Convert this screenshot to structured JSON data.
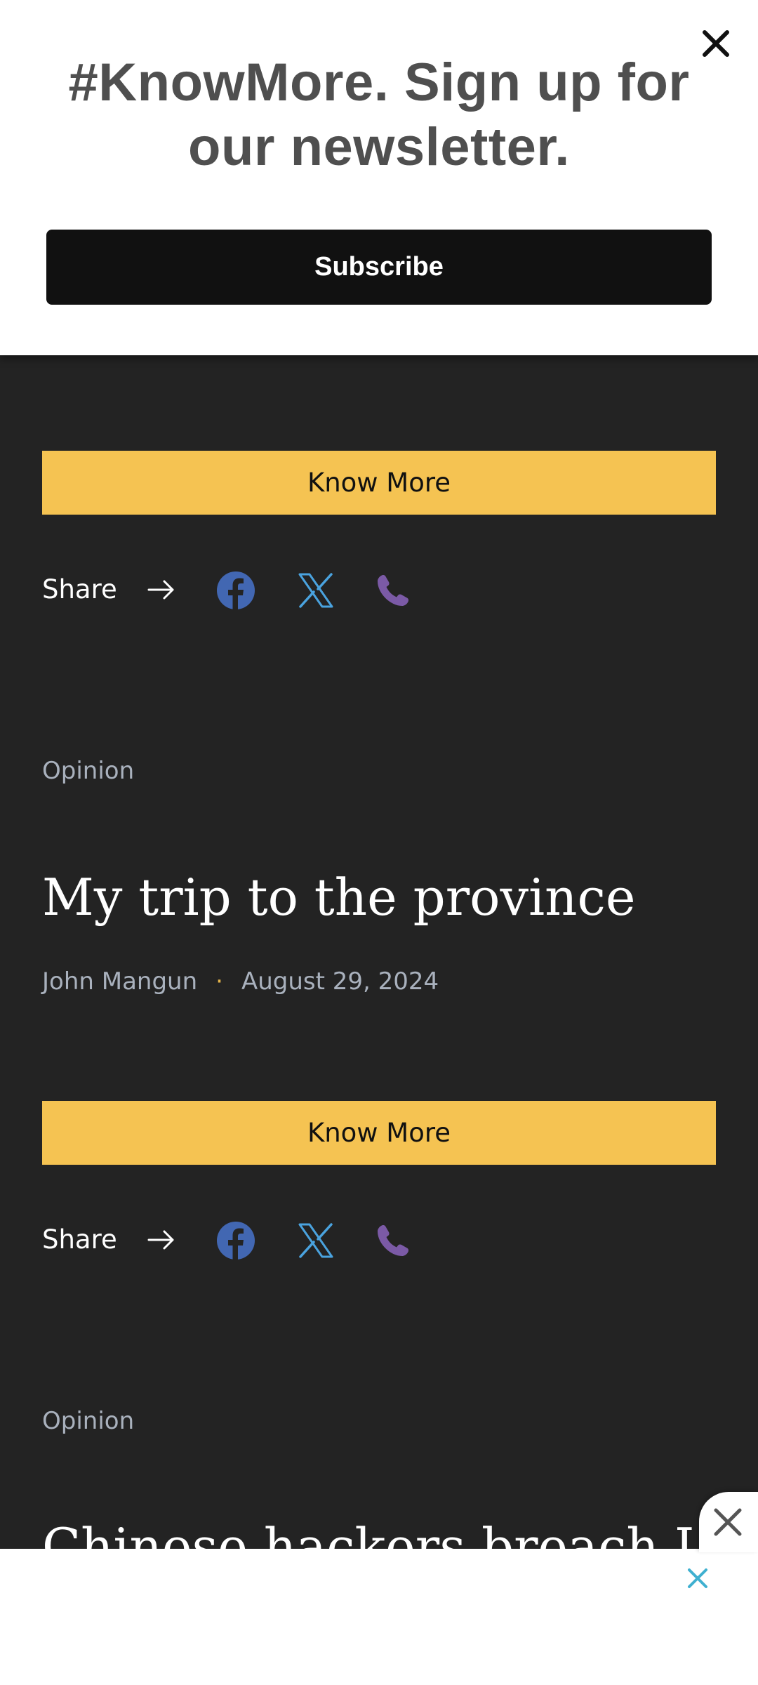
{
  "newsletter": {
    "title": "#KnowMore. Sign up for our newsletter.",
    "subscribe_label": "Subscribe"
  },
  "articles": [
    {
      "know_more_label": "Know More",
      "share_label": "Share"
    },
    {
      "category": "Opinion",
      "title": "My trip to the province",
      "author": "John Mangun",
      "separator": "·",
      "date": "August 29, 2024",
      "know_more_label": "Know More",
      "share_label": "Share"
    },
    {
      "category": "Opinion",
      "title": "Chinese hackers breach US"
    }
  ],
  "icons": {
    "close": "close-icon",
    "arrow": "arrow-right-icon",
    "facebook": "facebook-icon",
    "x": "x-twitter-icon",
    "phone": "phone-icon"
  },
  "colors": {
    "background": "#232323",
    "accent": "#f5c352",
    "facebook": "#4267b2",
    "x": "#4aa3df",
    "phone": "#7b5aa6"
  }
}
